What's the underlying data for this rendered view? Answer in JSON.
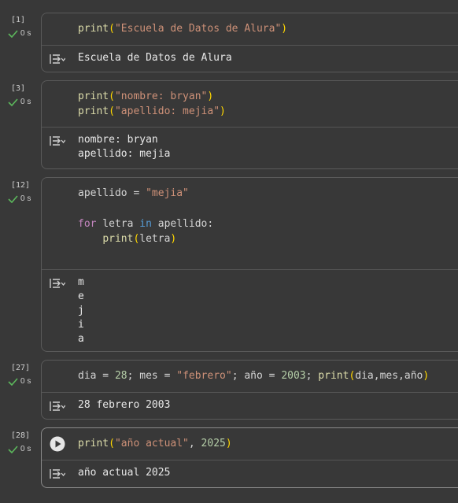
{
  "cells": [
    {
      "exec_count": "[1]",
      "status": "0 s",
      "code_tokens": [
        [
          [
            "print",
            "fn"
          ],
          [
            "(",
            "par"
          ],
          [
            "\"Escuela de Datos de Alura\"",
            "str"
          ],
          [
            ")",
            "par"
          ]
        ]
      ],
      "output": [
        "Escuela de Datos de Alura"
      ]
    },
    {
      "exec_count": "[3]",
      "status": "0 s",
      "code_tokens": [
        [
          [
            "print",
            "fn"
          ],
          [
            "(",
            "par"
          ],
          [
            "\"nombre: bryan\"",
            "str"
          ],
          [
            ")",
            "par"
          ]
        ],
        [
          [
            "print",
            "fn"
          ],
          [
            "(",
            "par"
          ],
          [
            "\"apellido: mejia\"",
            "str"
          ],
          [
            ")",
            "par"
          ]
        ]
      ],
      "output": [
        "nombre: bryan",
        "apellido: mejia"
      ]
    },
    {
      "exec_count": "[12]",
      "status": "0 s",
      "code_tokens": [
        [
          [
            "apellido = ",
            "id"
          ],
          [
            "\"mejia\"",
            "str"
          ]
        ],
        [],
        [
          [
            "for",
            "kw"
          ],
          [
            " letra ",
            "id"
          ],
          [
            "in",
            "kw2"
          ],
          [
            " apellido:",
            "id"
          ]
        ],
        [
          [
            "    ",
            "id"
          ],
          [
            "print",
            "fn"
          ],
          [
            "(",
            "par"
          ],
          [
            "letra",
            "id"
          ],
          [
            ")",
            "par"
          ]
        ]
      ],
      "output": [
        "m",
        "e",
        "j",
        "i",
        "a"
      ]
    },
    {
      "exec_count": "[27]",
      "status": "0 s",
      "code_tokens": [
        [
          [
            "dia = ",
            "id"
          ],
          [
            "28",
            "num"
          ],
          [
            "; mes = ",
            "id"
          ],
          [
            "\"febrero\"",
            "str"
          ],
          [
            "; año = ",
            "id"
          ],
          [
            "2003",
            "num"
          ],
          [
            "; ",
            "id"
          ],
          [
            "print",
            "fn"
          ],
          [
            "(",
            "par"
          ],
          [
            "dia,mes,año",
            "id"
          ],
          [
            ")",
            "par"
          ]
        ]
      ],
      "output": [
        "28 febrero 2003"
      ]
    },
    {
      "exec_count": "[28]",
      "status": "0 s",
      "code_tokens": [
        [
          [
            "print",
            "fn"
          ],
          [
            "(",
            "par"
          ],
          [
            "\"año actual\"",
            "str"
          ],
          [
            ", ",
            "id"
          ],
          [
            "2025",
            "num"
          ],
          [
            ")",
            "par"
          ]
        ]
      ],
      "output": [
        "año actual 2025"
      ]
    }
  ]
}
